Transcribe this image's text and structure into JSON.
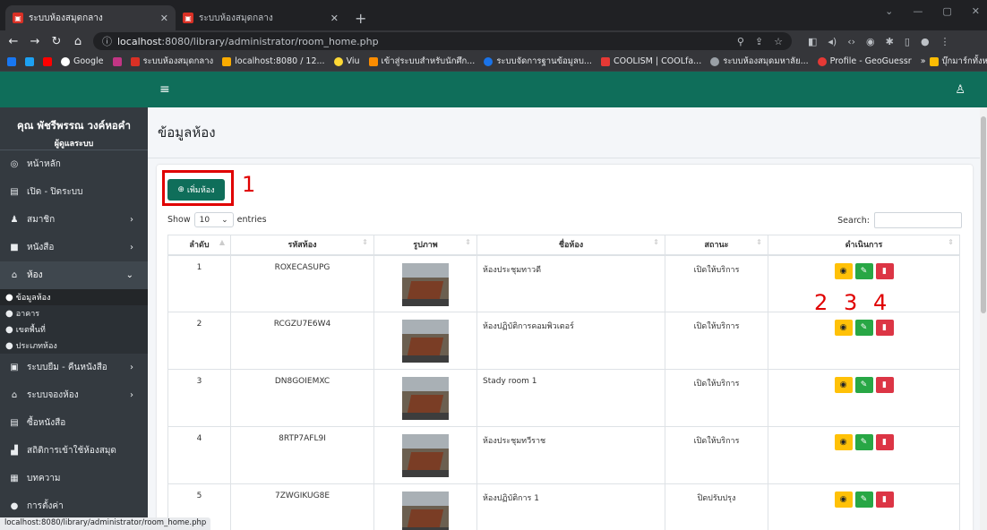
{
  "browser": {
    "tabs": [
      {
        "title": "ระบบห้องสมุดกลาง",
        "active": true
      },
      {
        "title": "ระบบห้องสมุดกลาง",
        "active": false
      }
    ],
    "url_host": "localhost",
    "url_path": ":8080/library/administrator/room_home.php",
    "bookmarks": [
      "Google",
      "ระบบห้องสมุดกลาง",
      "localhost:8080 / 12...",
      "Viu",
      "เข้าสู่ระบบสำหรับนักศึก...",
      "ระบบจัดการฐานข้อมูลบ...",
      "COOLISM | COOLfa...",
      "ระบบห้องสมุดมหาลัย...",
      "Profile - GeoGuessr",
      "บุ๊กมาร์กทั้งหมด"
    ],
    "status_url": "localhost:8080/library/administrator/room_home.php"
  },
  "profile": {
    "name": "คุณ พัชรีพรรณ วงค์หอคำ",
    "role": "ผู้ดูแลระบบ"
  },
  "menu": [
    {
      "label": "หน้าหลัก",
      "icon": "dashboard-icon"
    },
    {
      "label": "เปิด - ปิดระบบ",
      "icon": "file-icon"
    },
    {
      "label": "สมาชิก",
      "icon": "user-icon",
      "arrow": ">"
    },
    {
      "label": "หนังสือ",
      "icon": "book-icon",
      "arrow": ">"
    },
    {
      "label": "ห้อง",
      "icon": "home-icon",
      "arrow": "v"
    },
    {
      "label": "ระบบยืม - คืนหนังสือ",
      "icon": "form-icon",
      "arrow": ">"
    },
    {
      "label": "ระบบจองห้อง",
      "icon": "booking-icon",
      "arrow": ">"
    },
    {
      "label": "ซื้อหนังสือ",
      "icon": "file-icon"
    },
    {
      "label": "สถิติการเข้าใช้ห้องสมุด",
      "icon": "chart-icon"
    },
    {
      "label": "บทความ",
      "icon": "news-icon"
    },
    {
      "label": "การตั้งค่า",
      "icon": "info-icon"
    }
  ],
  "submenu": [
    "ข้อมูลห้อง",
    "อาคาร",
    "เขตพื้นที่",
    "ประเภทห้อง"
  ],
  "page": {
    "title": "ข้อมูลห้อง",
    "add_button": "เพิ่มห้อง",
    "show_label": "Show",
    "entries_value": "10",
    "entries_label": "entries",
    "search_label": "Search:",
    "annotations": [
      "1",
      "2",
      "3",
      "4"
    ]
  },
  "table": {
    "headers": [
      "ลำดับ",
      "รหัสห้อง",
      "รูปภาพ",
      "ชื่อห้อง",
      "สถานะ",
      "ดำเนินการ"
    ],
    "rows": [
      {
        "no": "1",
        "code": "ROXECASUPG",
        "name": "ห้องประชุมทาวดี",
        "status": "เปิดให้บริการ"
      },
      {
        "no": "2",
        "code": "RCGZU7E6W4",
        "name": "ห้องปฏิบัติการคอมพิวเตอร์",
        "status": "เปิดให้บริการ"
      },
      {
        "no": "3",
        "code": "DN8GOIEMXC",
        "name": "Stady room 1",
        "status": "เปิดให้บริการ"
      },
      {
        "no": "4",
        "code": "8RTP7AFL9I",
        "name": "ห้องประชุมทวีราช",
        "status": "เปิดให้บริการ"
      },
      {
        "no": "5",
        "code": "7ZWGIKUG8E",
        "name": "ห้องปฏิบัติการ 1",
        "status": "ปิดปรับปรุง"
      }
    ]
  },
  "colors": {
    "brand": "#0f6e5a",
    "sidebar": "#343a40",
    "view": "#ffc107",
    "edit": "#28a745",
    "delete": "#dc3545",
    "annotation": "#e00000"
  }
}
